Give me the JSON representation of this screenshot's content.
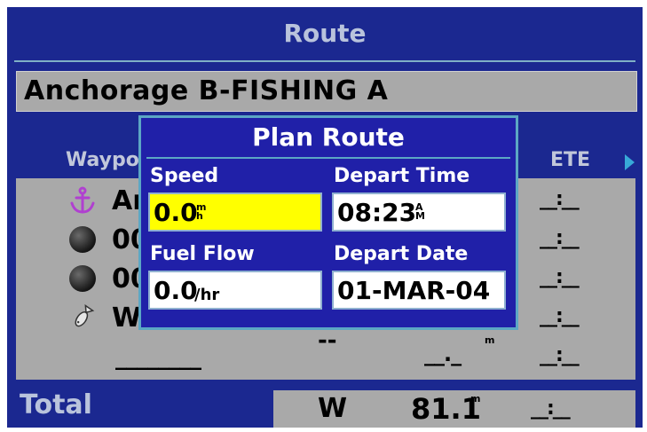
{
  "screen": {
    "title": "Route"
  },
  "route": {
    "name": "Anchorage B-FISHING A"
  },
  "table": {
    "header_waypoint": "Waypo",
    "header_ete": "ETE",
    "rows": [
      {
        "icon": "anchor-icon",
        "name": "An",
        "ete": "__:__"
      },
      {
        "icon": "dark-ball-icon",
        "name": "00",
        "ete": "__:__"
      },
      {
        "icon": "dark-ball-icon",
        "name": "00",
        "ete": "__:__"
      },
      {
        "icon": "fish-icon",
        "name": "Wa",
        "ete": "__:__"
      },
      {
        "icon": "",
        "name": "________",
        "ete": "__:__",
        "dist_placeholder": "--",
        "dist_value": "__._",
        "dist_unit": "m"
      }
    ]
  },
  "total": {
    "label": "Total",
    "direction": "W",
    "distance": "81.1",
    "distance_unit": "m",
    "ete": "__:__"
  },
  "plan_route": {
    "title": "Plan Route",
    "speed_label": "Speed",
    "speed_value": "0.0",
    "speed_unit_top": "m",
    "speed_unit_bottom": "h",
    "depart_time_label": "Depart Time",
    "depart_time_value": "08:23",
    "depart_time_ampm_top": "A",
    "depart_time_ampm_bottom": "M",
    "fuel_flow_label": "Fuel Flow",
    "fuel_flow_value": "0.0",
    "fuel_flow_unit": "/hr",
    "depart_date_label": "Depart Date",
    "depart_date_value": "01-MAR-04"
  },
  "colors": {
    "background": "#1b2890",
    "panel_gray": "#a9a9a9",
    "popup_blue": "#2020a8",
    "highlight_yellow": "#ffff00",
    "accent_cyan": "#38a9d8",
    "anchor_purple": "#b040d0"
  }
}
